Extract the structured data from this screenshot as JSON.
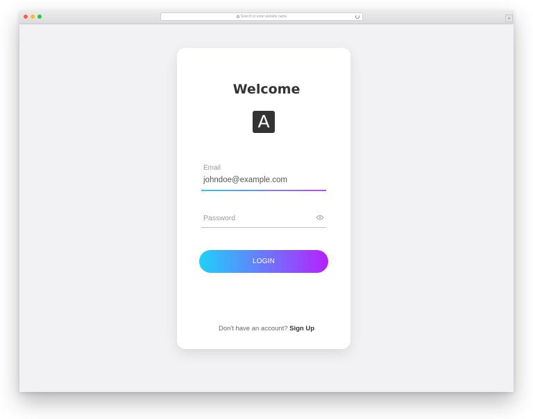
{
  "browser": {
    "address_placeholder": "Search or enter website name",
    "newtab_label": "+"
  },
  "login": {
    "title": "Welcome",
    "logo_letter": "A",
    "email_label": "Email",
    "email_value": "johndoe@example.com",
    "password_placeholder": "Password",
    "button_label": "LOGIN",
    "signup_prompt": "Don't have an account?",
    "signup_link": "Sign Up"
  },
  "colors": {
    "page_background": "#f2f2f4",
    "card_background": "#ffffff",
    "button_gradient_start": "#1fd1f9",
    "button_gradient_end": "#b621fe",
    "title_color": "#333333"
  },
  "icons": [
    "search-icon",
    "reload-icon",
    "eye-icon"
  ]
}
